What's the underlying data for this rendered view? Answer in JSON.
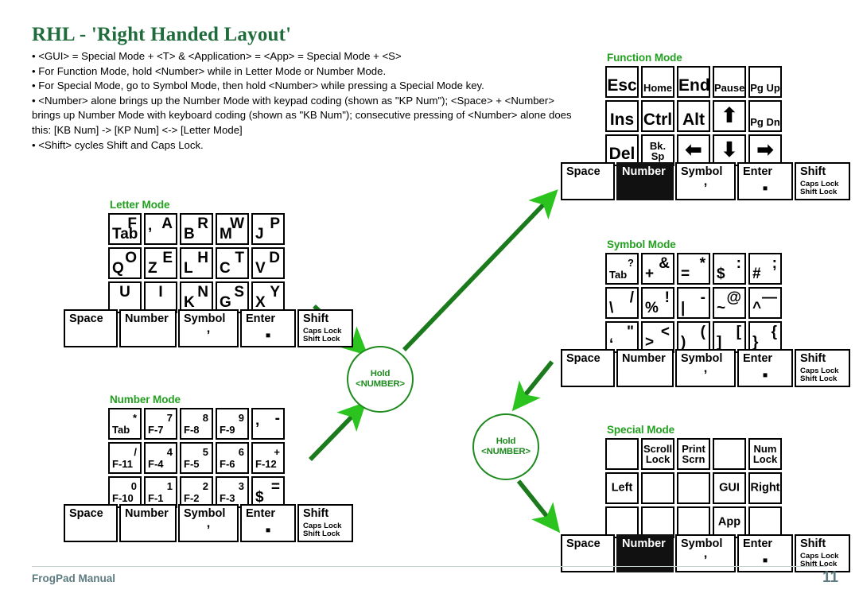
{
  "header": {
    "title": "RHL - 'Right Handed Layout'",
    "bullets": [
      "• <GUI> = Special Mode + <T>  &  <Application> = <App> = Special Mode + <S>",
      "• For Function Mode, hold <Number> while in Letter Mode or Number Mode.",
      "• For Special Mode, go to Symbol Mode, then hold <Number> while pressing a Special Mode key.",
      "• <Number> alone brings up the Number Mode with keypad coding (shown as \"KP Num\"); <Space> + <Number> brings up Number Mode with keyboard coding (shown as \"KB Num\"); consecutive pressing of <Number> alone does this: [KB Num]  -> [KP Num] <-> [Letter Mode]",
      "• <Shift> cycles Shift and Caps Lock."
    ]
  },
  "footer": {
    "label": "FrogPad Manual",
    "page": "11"
  },
  "colors": {
    "title_green": "#1f6b3b",
    "mode_green": "#22a01f",
    "arrow_green": "#1f8a1f",
    "footer_slate": "#5d7b80",
    "key_border": "#000000",
    "highlight_bg": "#111111"
  },
  "modifier_row": {
    "space": "Space",
    "number": "Number",
    "symbol": "Symbol",
    "symbol_sub": "’",
    "enter": "Enter",
    "enter_sub": "▪",
    "shift": "Shift",
    "shift_sub1": "Caps Lock",
    "shift_sub2": "Shift Lock"
  },
  "flow": {
    "hold1_line1": "Hold",
    "hold1_line2": "<NUMBER>",
    "hold2_line1": "Hold",
    "hold2_line2": "<NUMBER>"
  },
  "modes": {
    "letter": {
      "title": "Letter Mode",
      "style": "dual",
      "keys": [
        [
          {
            "prim": "Tab",
            "sec": "F",
            "small_prim": false
          },
          {
            "prim": "’",
            "sec": "A"
          },
          {
            "prim": "B",
            "sec": "R"
          },
          {
            "prim": "M",
            "sec": "W"
          },
          {
            "prim": "J",
            "sec": "P"
          }
        ],
        [
          {
            "prim": "Q",
            "sec": "O"
          },
          {
            "prim": "Z",
            "sec": "E"
          },
          {
            "prim": "L",
            "sec": "H"
          },
          {
            "prim": "C",
            "sec": "T"
          },
          {
            "prim": "V",
            "sec": "D"
          }
        ],
        [
          {
            "prim": "",
            "sec": "U",
            "sec_center": true
          },
          {
            "prim": "",
            "sec": "I",
            "sec_center": true
          },
          {
            "prim": "K",
            "sec": "N"
          },
          {
            "prim": "G",
            "sec": "S"
          },
          {
            "prim": "X",
            "sec": "Y"
          }
        ]
      ],
      "number_highlight": false
    },
    "number": {
      "title": "Number Mode",
      "style": "dual",
      "keys": [
        [
          {
            "prim": "Tab",
            "sec": "*",
            "small_prim": true
          },
          {
            "prim": "F-7",
            "sec": "7",
            "small_prim": true
          },
          {
            "prim": "F-8",
            "sec": "8",
            "small_prim": true
          },
          {
            "prim": "F-9",
            "sec": "9",
            "small_prim": true
          },
          {
            "prim": "’",
            "sec": "-"
          }
        ],
        [
          {
            "prim": "F-11",
            "sec": "/",
            "small_prim": true
          },
          {
            "prim": "F-4",
            "sec": "4",
            "small_prim": true
          },
          {
            "prim": "F-5",
            "sec": "5",
            "small_prim": true
          },
          {
            "prim": "F-6",
            "sec": "6",
            "small_prim": true
          },
          {
            "prim": "F-12",
            "sec": "+",
            "small_prim": true
          }
        ],
        [
          {
            "prim": "F-10",
            "sec": "0",
            "small_prim": true
          },
          {
            "prim": "F-1",
            "sec": "1",
            "small_prim": true
          },
          {
            "prim": "F-2",
            "sec": "2",
            "small_prim": true
          },
          {
            "prim": "F-3",
            "sec": "3",
            "small_prim": true
          },
          {
            "prim": "$",
            "sec": "="
          }
        ]
      ],
      "number_highlight": false
    },
    "function": {
      "title": "Function Mode",
      "style": "center",
      "keys": [
        [
          {
            "text": "Esc",
            "size": "big"
          },
          {
            "text": "Home",
            "size": "mid"
          },
          {
            "text": "End",
            "size": "big"
          },
          {
            "text": "Pause",
            "size": "mid"
          },
          {
            "text": "Pg Up",
            "size": "mid"
          }
        ],
        [
          {
            "text": "Ins",
            "size": "big"
          },
          {
            "text": "Ctrl",
            "size": "big"
          },
          {
            "text": "Alt",
            "size": "big"
          },
          {
            "text": "⬆",
            "size": "arrow"
          },
          {
            "text": "Pg Dn",
            "size": "mid"
          }
        ],
        [
          {
            "text": "Del",
            "size": "big"
          },
          {
            "text": "Bk. Sp",
            "size": "mid"
          },
          {
            "text": "⬅",
            "size": "arrow"
          },
          {
            "text": "⬇",
            "size": "arrow"
          },
          {
            "text": "➡",
            "size": "arrow"
          }
        ]
      ],
      "number_highlight": true
    },
    "symbol": {
      "title": "Symbol Mode",
      "style": "dual",
      "keys": [
        [
          {
            "prim": "Tab",
            "sec": "?",
            "small_prim": true
          },
          {
            "prim": "+",
            "sec": "&"
          },
          {
            "prim": "=",
            "sec": "*"
          },
          {
            "prim": "$",
            "sec": ":"
          },
          {
            "prim": "#",
            "sec": ";"
          }
        ],
        [
          {
            "prim": "\\",
            "sec": "/"
          },
          {
            "prim": "%",
            "sec": "!"
          },
          {
            "prim": "|",
            "sec": "-"
          },
          {
            "prim": "~",
            "sec": "@"
          },
          {
            "prim": "^",
            "sec": "—"
          }
        ],
        [
          {
            "prim": "‘",
            "sec": "\"",
            "prim_low": true
          },
          {
            "prim": ">",
            "sec": "<"
          },
          {
            "prim": ")",
            "sec": "("
          },
          {
            "prim": "]",
            "sec": "["
          },
          {
            "prim": "}",
            "sec": "{"
          }
        ]
      ],
      "number_highlight": false
    },
    "special": {
      "title": "Special Mode",
      "style": "center",
      "keys": [
        [
          {
            "text": "",
            "size": "two"
          },
          {
            "text": "Scroll\nLock",
            "size": "two"
          },
          {
            "text": "Print\nScrn",
            "size": "two"
          },
          {
            "text": "",
            "size": "two"
          },
          {
            "text": "Num\nLock",
            "size": "two"
          }
        ],
        [
          {
            "text": "Left",
            "size": "middle"
          },
          {
            "text": "",
            "size": "middle"
          },
          {
            "text": "",
            "size": "middle"
          },
          {
            "text": "GUI",
            "size": "middle"
          },
          {
            "text": "Right",
            "size": "middle"
          }
        ],
        [
          {
            "text": "",
            "size": "middle"
          },
          {
            "text": "",
            "size": "middle"
          },
          {
            "text": "",
            "size": "middle"
          },
          {
            "text": "App",
            "size": "middle"
          },
          {
            "text": "",
            "size": "middle"
          }
        ]
      ],
      "number_highlight": true
    }
  }
}
